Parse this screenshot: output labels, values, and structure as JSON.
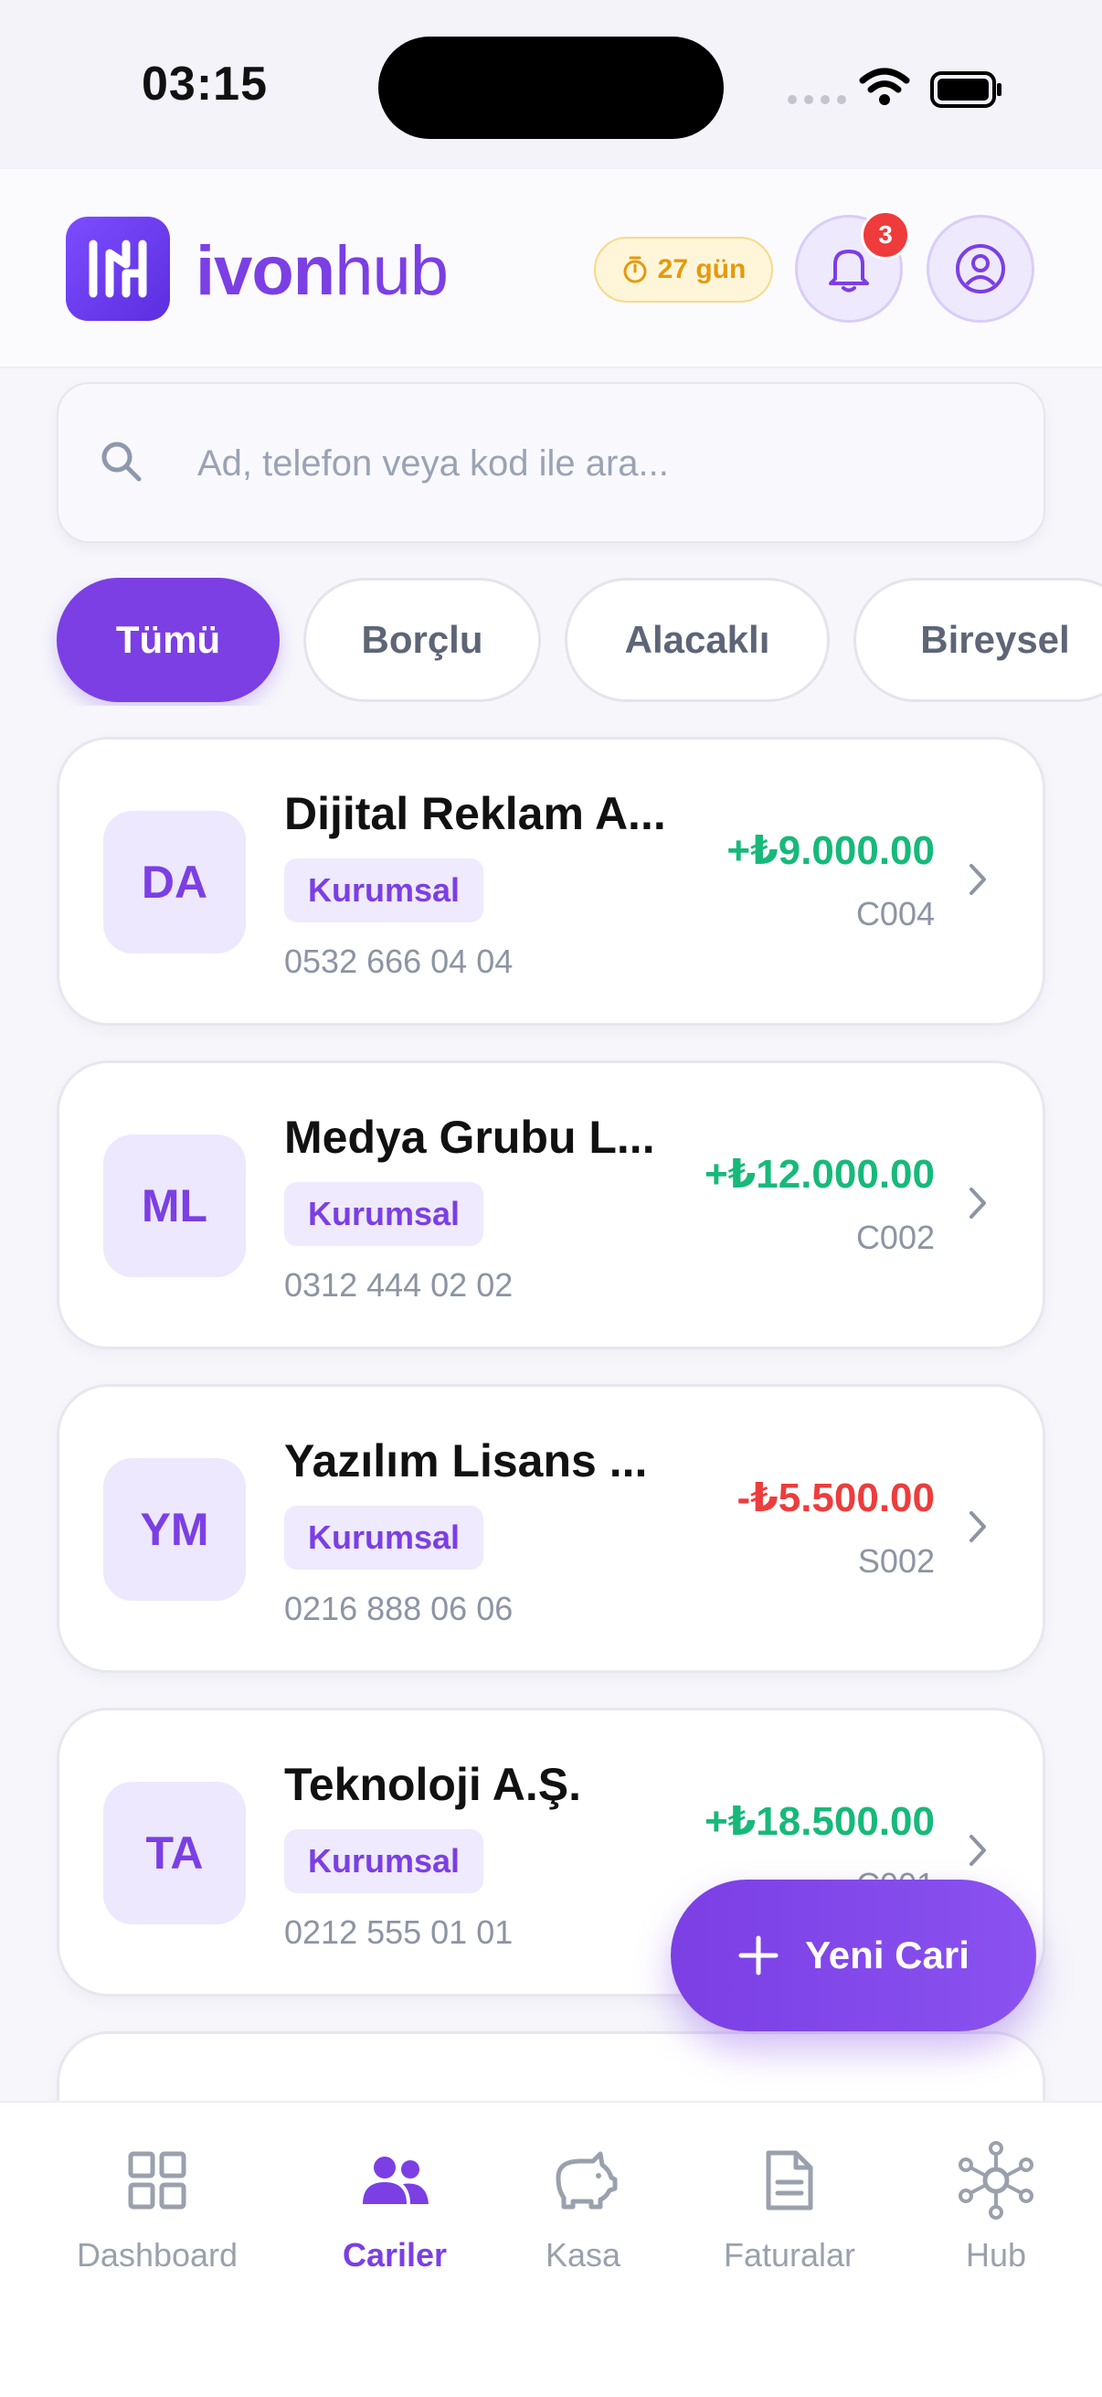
{
  "status_bar": {
    "time": "03:15"
  },
  "header": {
    "logo_bold": "ivon",
    "logo_light": "hub",
    "trial_label": "27 gün",
    "notification_count": "3"
  },
  "search": {
    "placeholder": "Ad, telefon veya kod ile ara..."
  },
  "filters": [
    {
      "label": "Tümü",
      "active": true
    },
    {
      "label": "Borçlu",
      "active": false
    },
    {
      "label": "Alacaklı",
      "active": false
    },
    {
      "label": "Bireysel",
      "active": false
    }
  ],
  "accounts": [
    {
      "initials": "DA",
      "name": "Dijital Reklam A...",
      "tag": "Kurumsal",
      "phone": "0532 666 04 04",
      "amount": "+₺9.000.00",
      "code": "C004",
      "sign": "positive"
    },
    {
      "initials": "ML",
      "name": "Medya Grubu L...",
      "tag": "Kurumsal",
      "phone": "0312 444 02 02",
      "amount": "+₺12.000.00",
      "code": "C002",
      "sign": "positive"
    },
    {
      "initials": "YM",
      "name": "Yazılım Lisans ...",
      "tag": "Kurumsal",
      "phone": "0216 888 06 06",
      "amount": "-₺5.500.00",
      "code": "S002",
      "sign": "negative"
    },
    {
      "initials": "TA",
      "name": "Teknoloji A.Ş.",
      "tag": "Kurumsal",
      "phone": "0212 555 01 01",
      "amount": "+₺18.500.00",
      "code": "C001",
      "sign": "positive"
    }
  ],
  "fab": {
    "label": "Yeni Cari"
  },
  "bottom_nav": [
    {
      "label": "Dashboard",
      "icon": "grid-icon",
      "active": false
    },
    {
      "label": "Cariler",
      "icon": "users-icon",
      "active": true
    },
    {
      "label": "Kasa",
      "icon": "piggy-bank-icon",
      "active": false
    },
    {
      "label": "Faturalar",
      "icon": "document-icon",
      "active": false
    },
    {
      "label": "Hub",
      "icon": "network-hub-icon",
      "active": false
    }
  ],
  "colors": {
    "accent": "#7b3fe4",
    "positive": "#17b97a",
    "negative": "#ec3d3d",
    "warning": "#e49a0d"
  }
}
